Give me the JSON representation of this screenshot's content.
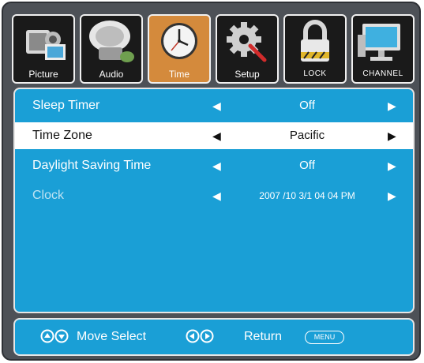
{
  "tabs": [
    {
      "label": "Picture",
      "icon": "camcorder-icon",
      "active": false
    },
    {
      "label": "Audio",
      "icon": "speaker-icon",
      "active": false
    },
    {
      "label": "Time",
      "icon": "clock-icon",
      "active": true
    },
    {
      "label": "Setup",
      "icon": "gear-icon",
      "active": false
    },
    {
      "label": "LOCK",
      "icon": "lock-icon",
      "active": false
    },
    {
      "label": "CHANNEL",
      "icon": "monitor-icon",
      "active": false
    }
  ],
  "menu": {
    "items": [
      {
        "label": "Sleep Timer",
        "value": "Off"
      },
      {
        "label": "Time Zone",
        "value": "Pacific",
        "selected": true
      },
      {
        "label": "Daylight Saving Time",
        "value": "Off"
      },
      {
        "label": "Clock",
        "value": "2007 /10 3/1 04 04 PM",
        "disabled": true
      }
    ]
  },
  "footer": {
    "move_label": "Move Select",
    "return_label": "Return",
    "menu_button": "MENU",
    "icons": [
      "up-down-buttons-icon",
      "left-right-buttons-icon",
      "menu-button-icon"
    ]
  },
  "colors": {
    "panel_blue": "#1a9fd6",
    "frame_gray": "#4d5157",
    "active_tab_orange": "#d48a3c",
    "selected_row": "#ffffff"
  }
}
